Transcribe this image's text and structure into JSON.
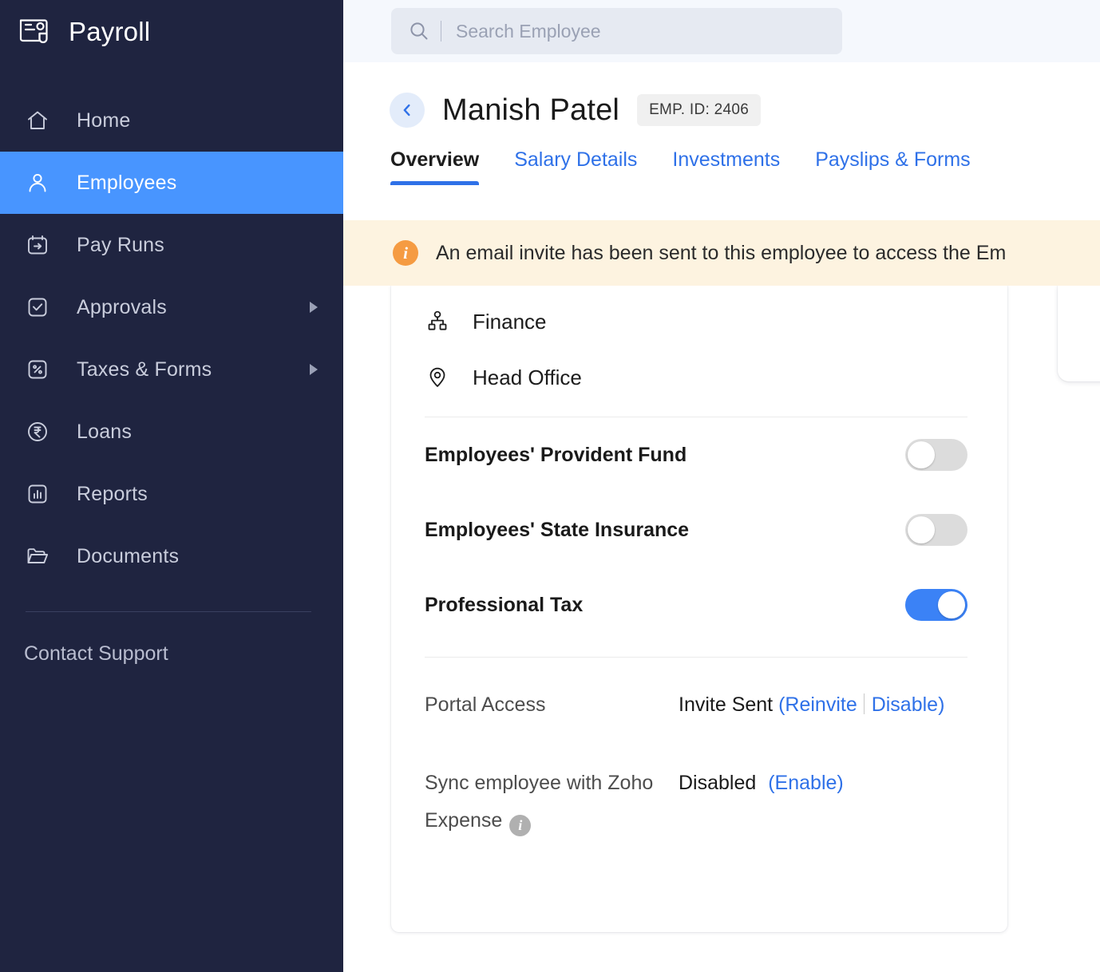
{
  "sidebar": {
    "brand": {
      "title": "Payroll",
      "logo_icon": "payroll-card-icon"
    },
    "items": [
      {
        "label": "Home",
        "icon": "home-icon",
        "active": false,
        "caret": false
      },
      {
        "label": "Employees",
        "icon": "person-icon",
        "active": true,
        "caret": false
      },
      {
        "label": "Pay Runs",
        "icon": "calendar-arrow-icon",
        "active": false,
        "caret": false
      },
      {
        "label": "Approvals",
        "icon": "check-square-icon",
        "active": false,
        "caret": true
      },
      {
        "label": "Taxes & Forms",
        "icon": "percent-square-icon",
        "active": false,
        "caret": true
      },
      {
        "label": "Loans",
        "icon": "rupee-circle-icon",
        "active": false,
        "caret": false
      },
      {
        "label": "Reports",
        "icon": "bar-chart-icon",
        "active": false,
        "caret": false
      },
      {
        "label": "Documents",
        "icon": "folder-icon",
        "active": false,
        "caret": false
      }
    ],
    "support_label": "Contact Support"
  },
  "search": {
    "placeholder": "Search Employee",
    "value": "",
    "icon": "search-icon"
  },
  "employee_header": {
    "back_icon": "chevron-left-icon",
    "name": "Manish Patel",
    "badge": "EMP. ID: 2406"
  },
  "tabs": [
    {
      "label": "Overview",
      "active": true
    },
    {
      "label": "Salary Details",
      "active": false
    },
    {
      "label": "Investments",
      "active": false
    },
    {
      "label": "Payslips & Forms",
      "active": false
    }
  ],
  "banner": {
    "icon": "info-circle-icon",
    "text": "An email invite has been sent to this employee to access the Em"
  },
  "card": {
    "meta": [
      {
        "label": "Finance",
        "icon": "org-chart-icon"
      },
      {
        "label": "Head Office",
        "icon": "location-pin-icon"
      }
    ],
    "toggles": [
      {
        "label": "Employees' Provident Fund",
        "on": false
      },
      {
        "label": "Employees' State Insurance",
        "on": false
      },
      {
        "label": "Professional Tax",
        "on": true
      }
    ],
    "details": [
      {
        "key": "Portal Access",
        "value": "Invite Sent",
        "link1": "(Reinvite",
        "link2": "Disable)",
        "separator": true
      },
      {
        "key": "Sync employee with Zoho Expense",
        "key_has_info_icon": true,
        "value": "Disabled",
        "link1": "(Enable)",
        "highlighted": true
      }
    ]
  },
  "colors": {
    "sidebar_bg": "#1f2440",
    "accent_blue": "#4895ff",
    "link_blue": "#2f71e8",
    "banner_bg": "#fdf3e0",
    "banner_icon": "#f59b42",
    "toggle_on": "#3b82f6",
    "highlight_red": "#fb2a0d"
  }
}
